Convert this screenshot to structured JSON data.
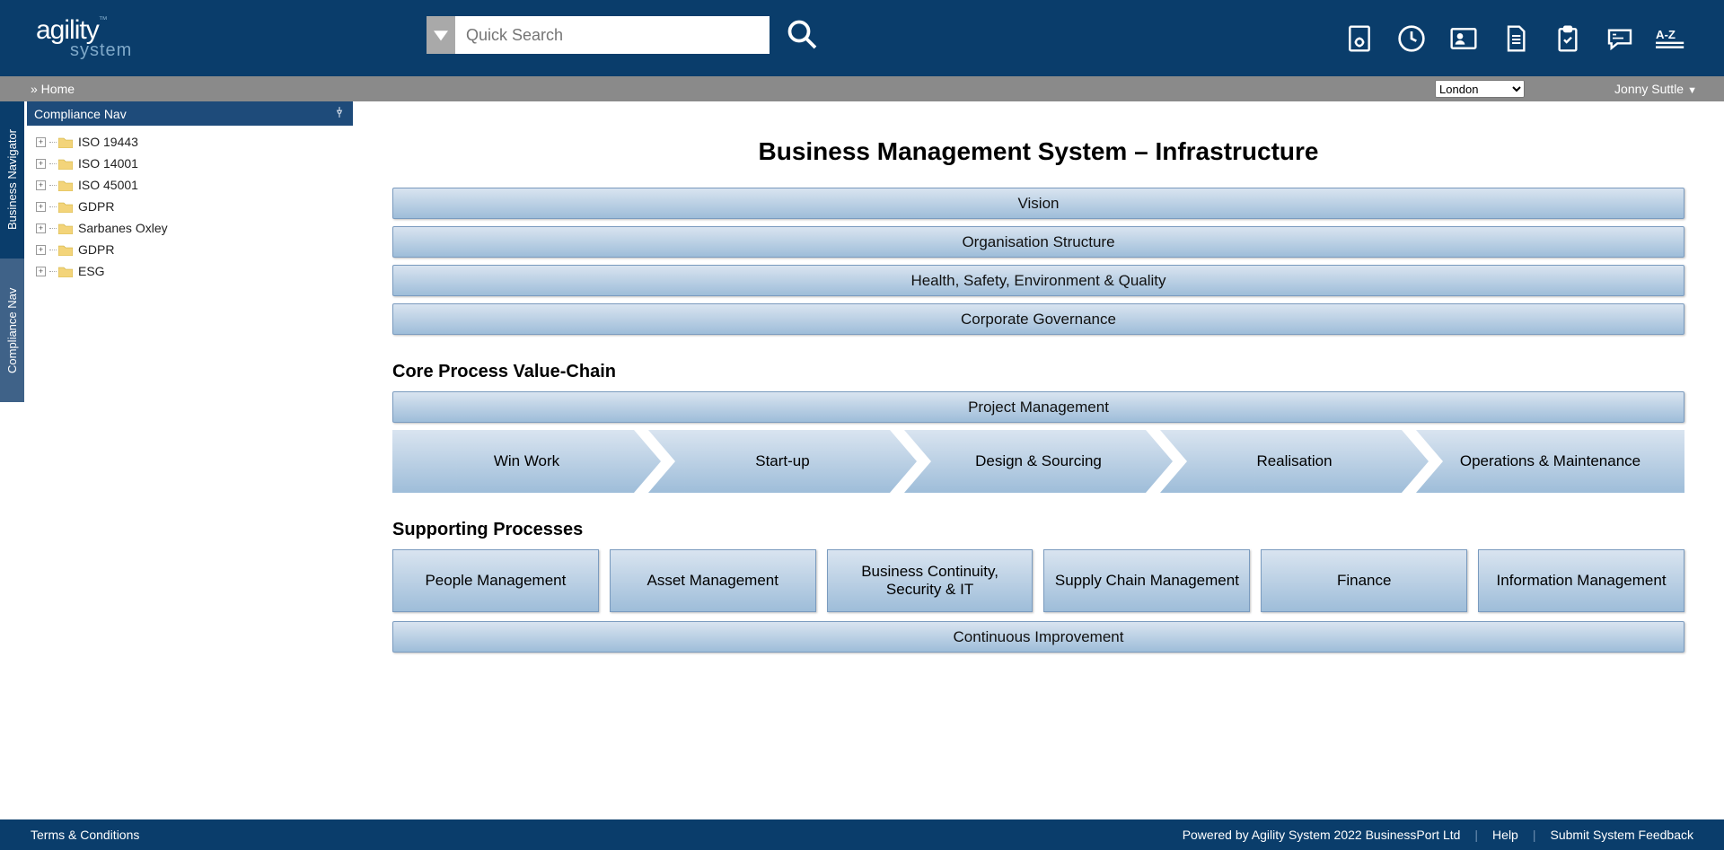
{
  "header": {
    "logo_main": "agility",
    "logo_tm": "™",
    "logo_sub": "system",
    "search_placeholder": "Quick Search",
    "icons": [
      "settings-doc-icon",
      "clock-icon",
      "contact-card-icon",
      "document-icon",
      "clipboard-check-icon",
      "speech-icon",
      "az-icon"
    ]
  },
  "breadcrumb": {
    "home": "» Home",
    "location_selected": "London",
    "user": "Jonny Suttle"
  },
  "sidetabs": {
    "inactive": "Business Navigator",
    "active": "Compliance Nav"
  },
  "nav_panel": {
    "title": "Compliance Nav",
    "items": [
      {
        "label": "ISO 19443"
      },
      {
        "label": "ISO 14001"
      },
      {
        "label": "ISO 45001"
      },
      {
        "label": "GDPR"
      },
      {
        "label": "Sarbanes Oxley"
      },
      {
        "label": "GDPR"
      },
      {
        "label": "ESG"
      }
    ]
  },
  "main": {
    "title": "Business Management System – Infrastructure",
    "top_bars": [
      "Vision",
      "Organisation Structure",
      "Health, Safety, Environment & Quality",
      "Corporate Governance"
    ],
    "core_heading": "Core Process Value-Chain",
    "core_bar": "Project Management",
    "chevrons": [
      "Win Work",
      "Start-up",
      "Design & Sourcing",
      "Realisation",
      "Operations & Maintenance"
    ],
    "support_heading": "Supporting Processes",
    "support_boxes": [
      "People Management",
      "Asset Management",
      "Business Continuity, Security & IT",
      "Supply Chain Management",
      "Finance",
      "Information Management"
    ],
    "support_bar": "Continuous Improvement"
  },
  "footer": {
    "terms": "Terms & Conditions",
    "powered": "Powered by Agility System 2022 BusinessPort Ltd",
    "help": "Help",
    "feedback": "Submit System Feedback"
  }
}
